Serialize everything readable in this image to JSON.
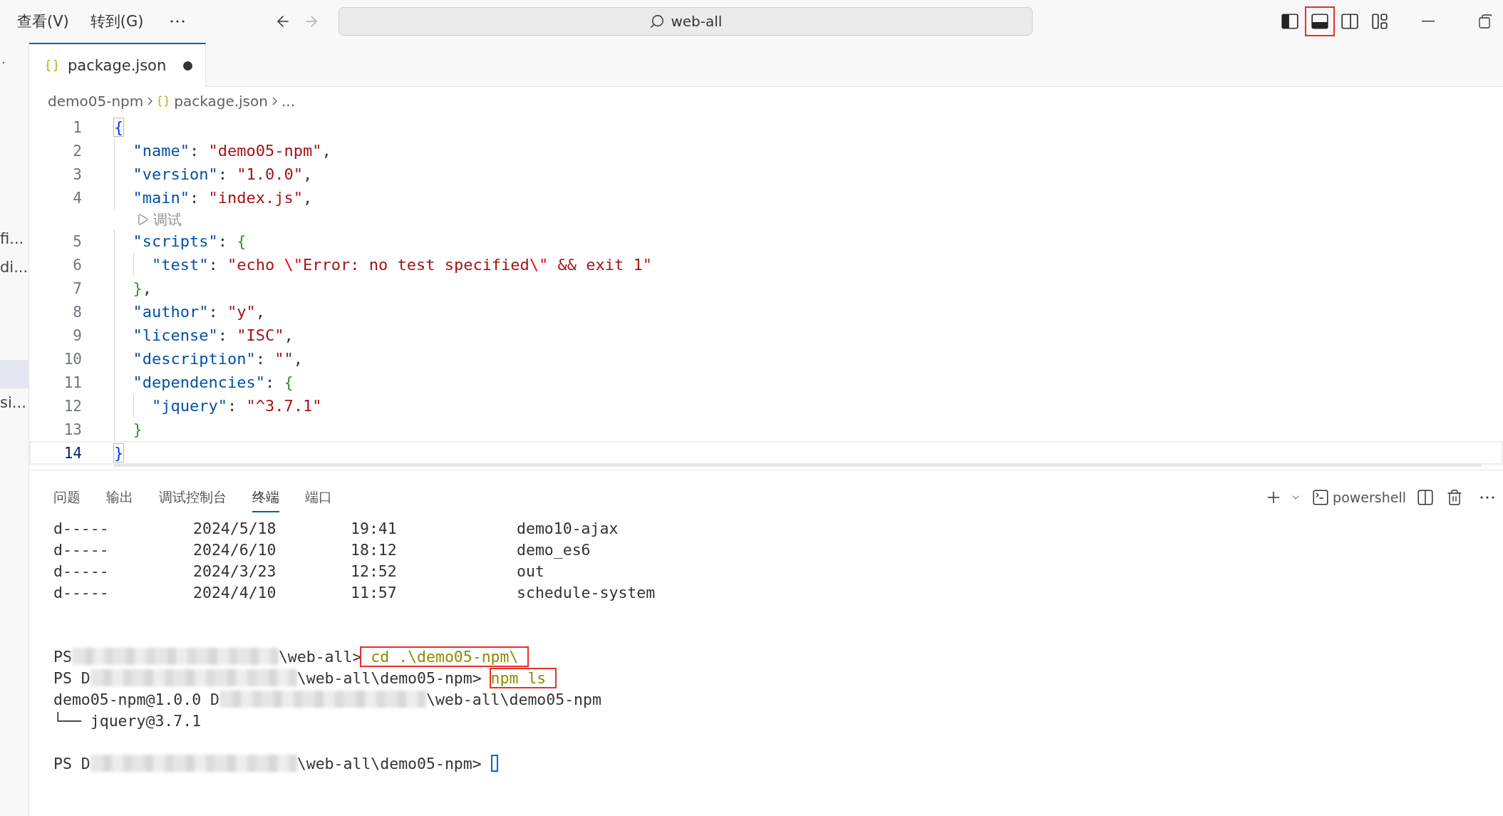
{
  "titlebar": {
    "menus": [
      "查看(V)",
      "转到(G)"
    ],
    "nav": [
      {
        "kind": "back",
        "disabled": false
      },
      {
        "kind": "forward",
        "disabled": true
      }
    ],
    "search": {
      "value": "web-all"
    },
    "layout_toggles": [
      {
        "kind": "primary-sidebar",
        "on": true,
        "highlighted": false
      },
      {
        "kind": "panel",
        "on": true,
        "highlighted": true
      },
      {
        "kind": "secondary-sidebar",
        "on": false,
        "highlighted": false
      },
      {
        "kind": "customize",
        "highlighted": false
      }
    ]
  },
  "sidebar": {
    "marker": "·",
    "items": [
      {
        "label": "fi...",
        "selected": false
      },
      {
        "label": "di...",
        "selected": false
      },
      {
        "selected": true
      },
      {
        "label": "si...",
        "selected": false
      }
    ]
  },
  "tabs": [
    {
      "label": "package.json",
      "selected": true,
      "dirty": true
    }
  ],
  "breadcrumb": [
    {
      "label": "demo05-npm",
      "file": false
    },
    {
      "label": "package.json",
      "file": true
    },
    {
      "label": "...",
      "file": false
    }
  ],
  "editor": {
    "lines": [
      {
        "number": "1",
        "active": false,
        "tokens": [
          {
            "kind": "brace1",
            "text": "{"
          }
        ]
      },
      {
        "number": "2",
        "active": false,
        "tokens": [
          {
            "kind": "key",
            "text": "  \"name\""
          },
          {
            "kind": "punct",
            "text": ": "
          },
          {
            "kind": "string",
            "text": "\"demo05-npm\""
          },
          {
            "kind": "punct",
            "text": ","
          }
        ]
      },
      {
        "number": "3",
        "active": false,
        "tokens": [
          {
            "kind": "key",
            "text": "  \"version\""
          },
          {
            "kind": "punct",
            "text": ": "
          },
          {
            "kind": "string",
            "text": "\"1.0.0\""
          },
          {
            "kind": "punct",
            "text": ","
          }
        ]
      },
      {
        "number": "4",
        "active": false,
        "tokens": [
          {
            "kind": "key",
            "text": "  \"main\""
          },
          {
            "kind": "punct",
            "text": ": "
          },
          {
            "kind": "string",
            "text": "\"index.js\""
          },
          {
            "kind": "punct",
            "text": ","
          }
        ]
      },
      {
        "kind": "codelens",
        "label": "调试"
      },
      {
        "number": "5",
        "active": false,
        "tokens": [
          {
            "kind": "key",
            "text": "  \"scripts\""
          },
          {
            "kind": "punct",
            "text": ": "
          },
          {
            "kind": "brace2",
            "text": "{"
          }
        ]
      },
      {
        "number": "6",
        "active": false,
        "tokens": [
          {
            "kind": "key",
            "text": "    \"test\""
          },
          {
            "kind": "punct",
            "text": ": "
          },
          {
            "kind": "string",
            "text": "\"echo "
          },
          {
            "kind": "escape",
            "text": "\\\""
          },
          {
            "kind": "string",
            "text": "Error: no test specified"
          },
          {
            "kind": "escape",
            "text": "\\\""
          },
          {
            "kind": "string",
            "text": " && exit 1\""
          }
        ]
      },
      {
        "number": "7",
        "active": false,
        "tokens": [
          {
            "kind": "brace2",
            "text": "  }"
          },
          {
            "kind": "punct",
            "text": ","
          }
        ]
      },
      {
        "number": "8",
        "active": false,
        "tokens": [
          {
            "kind": "key",
            "text": "  \"author\""
          },
          {
            "kind": "punct",
            "text": ": "
          },
          {
            "kind": "string",
            "text": "\"y\""
          },
          {
            "kind": "punct",
            "text": ","
          }
        ]
      },
      {
        "number": "9",
        "active": false,
        "tokens": [
          {
            "kind": "key",
            "text": "  \"license\""
          },
          {
            "kind": "punct",
            "text": ": "
          },
          {
            "kind": "string",
            "text": "\"ISC\""
          },
          {
            "kind": "punct",
            "text": ","
          }
        ]
      },
      {
        "number": "10",
        "active": false,
        "tokens": [
          {
            "kind": "key",
            "text": "  \"description\""
          },
          {
            "kind": "punct",
            "text": ": "
          },
          {
            "kind": "string",
            "text": "\"\""
          },
          {
            "kind": "punct",
            "text": ","
          }
        ]
      },
      {
        "number": "11",
        "active": false,
        "tokens": [
          {
            "kind": "key",
            "text": "  \"dependencies\""
          },
          {
            "kind": "punct",
            "text": ": "
          },
          {
            "kind": "brace2",
            "text": "{"
          }
        ]
      },
      {
        "number": "12",
        "active": false,
        "tokens": [
          {
            "kind": "key",
            "text": "    \"jquery\""
          },
          {
            "kind": "punct",
            "text": ": "
          },
          {
            "kind": "string",
            "text": "\"^3.7.1\""
          }
        ]
      },
      {
        "number": "13",
        "active": false,
        "tokens": [
          {
            "kind": "brace2",
            "text": "  }"
          }
        ]
      },
      {
        "number": "14",
        "active": true,
        "tokens": [
          {
            "kind": "brace1",
            "text": "}"
          }
        ]
      }
    ]
  },
  "panel": {
    "tabs": [
      {
        "label": "问题",
        "selected": false
      },
      {
        "label": "输出",
        "selected": false
      },
      {
        "label": "调试控制台",
        "selected": false
      },
      {
        "label": "终端",
        "selected": true
      },
      {
        "label": "端口",
        "selected": false
      }
    ],
    "terminal_name": "powershell",
    "lines": [
      {
        "kind": "entry",
        "mode": "d-----",
        "date": "2024/5/18",
        "time": "19:41",
        "name": "demo10-ajax"
      },
      {
        "kind": "entry",
        "mode": "d-----",
        "date": "2024/6/10",
        "time": "18:12",
        "name": "demo_es6"
      },
      {
        "kind": "entry",
        "mode": "d-----",
        "date": "2024/3/23",
        "time": "12:52",
        "name": "out"
      },
      {
        "kind": "entry",
        "mode": "d-----",
        "date": "2024/4/10",
        "time": "11:57",
        "name": "schedule-system"
      },
      {
        "kind": "blank"
      },
      {
        "kind": "blank"
      },
      {
        "kind": "output",
        "segments": [
          {
            "kind": "text",
            "text": "PS"
          },
          {
            "kind": "blur"
          },
          {
            "kind": "text",
            "text": "\\web-all>"
          },
          {
            "kind": "command",
            "text": " cd .\\demo05-npm\\ ",
            "highlighted": true
          }
        ]
      },
      {
        "kind": "output",
        "segments": [
          {
            "kind": "text",
            "text": "PS D"
          },
          {
            "kind": "blur"
          },
          {
            "kind": "text",
            "text": "\\web-all\\demo05-npm> "
          },
          {
            "kind": "command",
            "text": "npm ls ",
            "highlighted": true
          }
        ]
      },
      {
        "kind": "output",
        "segments": [
          {
            "kind": "text",
            "text": "demo05-npm@1.0.0 D"
          },
          {
            "kind": "blur"
          },
          {
            "kind": "text",
            "text": "\\web-all\\demo05-npm"
          }
        ]
      },
      {
        "kind": "output",
        "segments": [
          {
            "kind": "text",
            "text": "└── jquery@3.7.1"
          }
        ]
      },
      {
        "kind": "blank"
      },
      {
        "kind": "output",
        "segments": [
          {
            "kind": "text",
            "text": "PS D"
          },
          {
            "kind": "blur"
          },
          {
            "kind": "text",
            "text": "\\web-all\\demo05-npm> "
          },
          {
            "kind": "cursor"
          }
        ]
      }
    ]
  }
}
